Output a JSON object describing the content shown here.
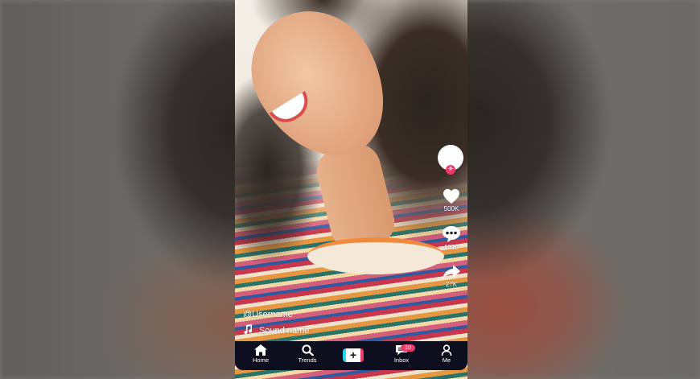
{
  "post": {
    "username": "@Username",
    "sound_name": "Sound name"
  },
  "actions": {
    "likes": "500K",
    "comments": "1320",
    "shares": "27K"
  },
  "nav": {
    "items": [
      {
        "label": "Home",
        "icon": "home-icon"
      },
      {
        "label": "Trends",
        "icon": "search-icon"
      },
      {
        "label": "",
        "icon": "create-plus-icon",
        "symbol": "+"
      },
      {
        "label": "Inbox",
        "icon": "inbox-icon",
        "badge": "10"
      },
      {
        "label": "Me",
        "icon": "profile-icon"
      }
    ]
  },
  "colors": {
    "accent_pink": "#ec3b6a",
    "accent_cyan": "#27d4e8",
    "nav_background": "#0d0f1e"
  }
}
